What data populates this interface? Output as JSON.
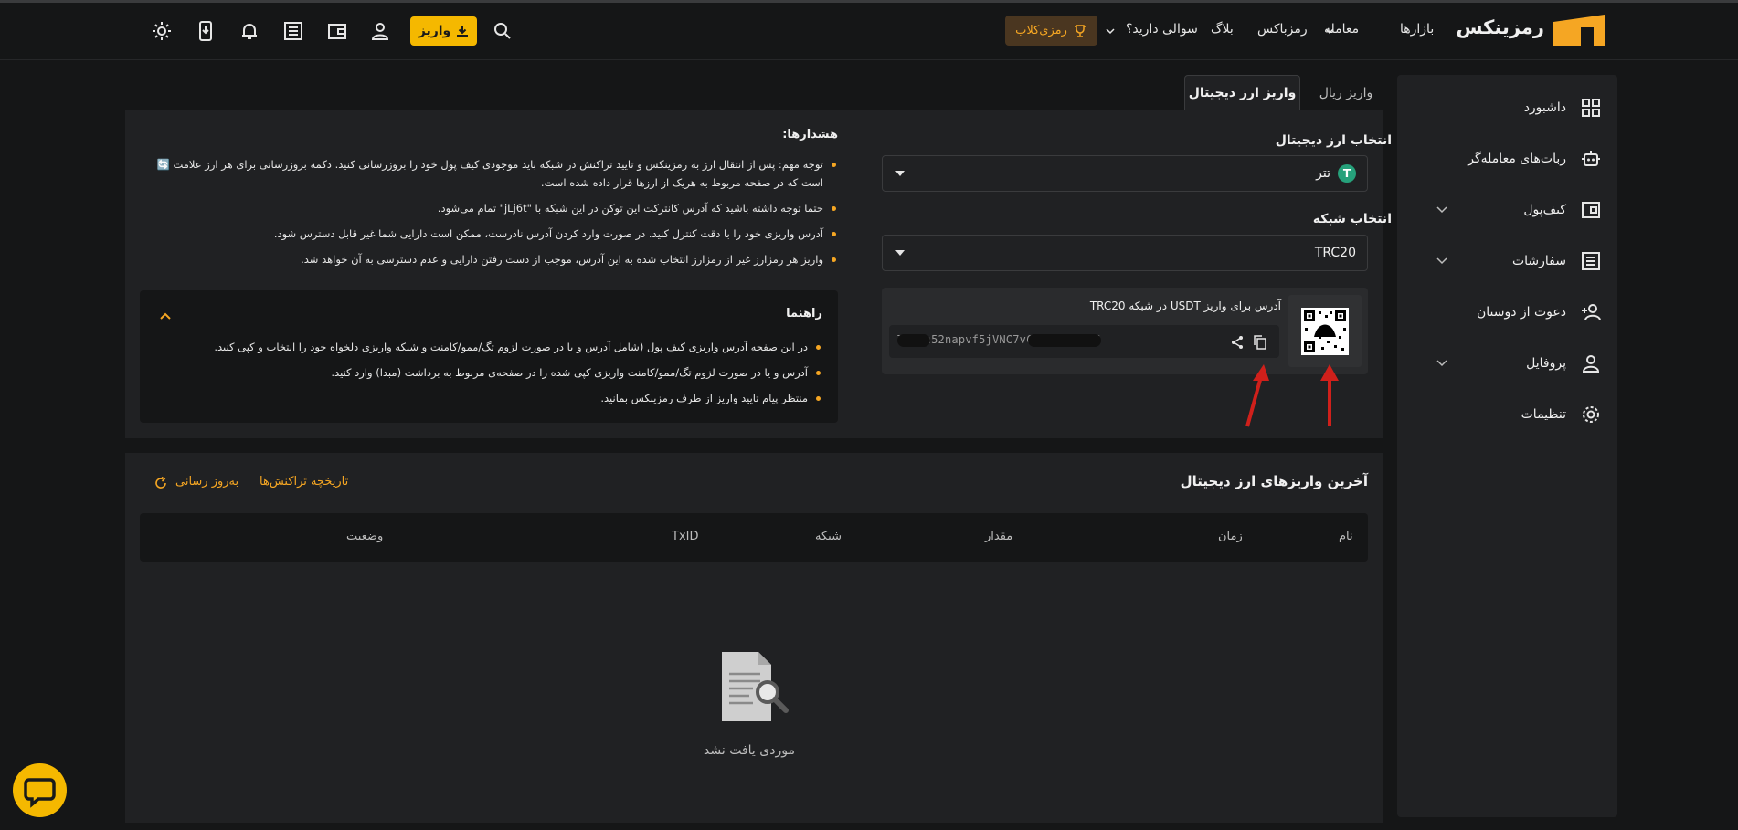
{
  "header": {
    "logo_text": "رمزینکس",
    "nav": [
      "بازارها",
      "معامله",
      "رمزباکس",
      "بلاگ",
      "سوالی دارید؟"
    ],
    "club_label": "رمزی‌کلاب",
    "deposit_label": "واریز"
  },
  "sidebar": {
    "items": [
      {
        "label": "داشبورد",
        "icon": "dashboard-icon"
      },
      {
        "label": "ربات‌های معامله‌گر",
        "icon": "robot-icon"
      },
      {
        "label": "کیف‌پول",
        "icon": "wallet-icon"
      },
      {
        "label": "سفارشات",
        "icon": "orders-icon"
      },
      {
        "label": "دعوت از دوستان",
        "icon": "invite-icon"
      },
      {
        "label": "پروفایل",
        "icon": "profile-icon"
      },
      {
        "label": "تنظیمات",
        "icon": "settings-icon"
      }
    ]
  },
  "tabs": {
    "active": "واریز ارز دیجیتال",
    "inactive": "واریز ریال"
  },
  "form": {
    "currency_label": "انتخاب ارز دیجیتال",
    "currency_value": "تتر",
    "currency_icon": "T",
    "network_label": "انتخاب شبکه",
    "network_value": "TRC20",
    "address_title": "آدرس برای واریز USDT در شبکه TRC20",
    "address_value": "TSnFh52napvf5jVNC7vCvSyWc1eoU6"
  },
  "warnings": {
    "title": "هشدارها:",
    "items": [
      "توجه مهم: پس از انتقال ارز به رمزینکس و تایید تراکنش در شبکه باید موجودی کیف پول خود را بروزرسانی کنید. دکمه بروزرسانی برای هر ارز علامت 🔄 است که در صفحه مربوط به هریک از ارزها قرار داده شده است.",
      "حتما توجه داشته باشید که آدرس کانترکت این توکن در این شبکه با \"jLj6t\" تمام می‌شود.",
      "آدرس واریزی خود را با دقت کنترل کنید. در صورت وارد کردن آدرس نادرست، ممکن است دارایی شما غیر قابل دسترس شود.",
      "واریز هر رمزارز غیر از رمزارز انتخاب شده به این آدرس، موجب از دست رفتن دارایی و عدم دسترسی به آن خواهد شد."
    ]
  },
  "guide": {
    "title": "راهنما",
    "items": [
      "در این صفحه آدرس واریزی کیف پول (شامل آدرس و یا در صورت لزوم تگ/ممو/کامنت و شبکه واریزی دلخواه خود را انتخاب و کپی کنید.",
      "آدرس و یا در صورت لزوم تگ/ممو/کامنت واریزی کپی شده را در صفحه‌ی مربوط به برداشت (مبدا) وارد کنید.",
      "منتظر پیام تایید واریز از طرف رمزینکس بمانید."
    ]
  },
  "history": {
    "title": "آخرین واریزهای ارز دیجیتال",
    "history_link": "تاریخچه تراکنش‌ها",
    "refresh_link": "به‌روز رسانی",
    "columns": [
      "نام",
      "زمان",
      "مقدار",
      "شبکه",
      "TxID",
      "وضعیت"
    ],
    "empty": "موردی یافت نشد"
  },
  "colors": {
    "accent": "#f5b800",
    "background": "#151617",
    "card": "#202123"
  }
}
